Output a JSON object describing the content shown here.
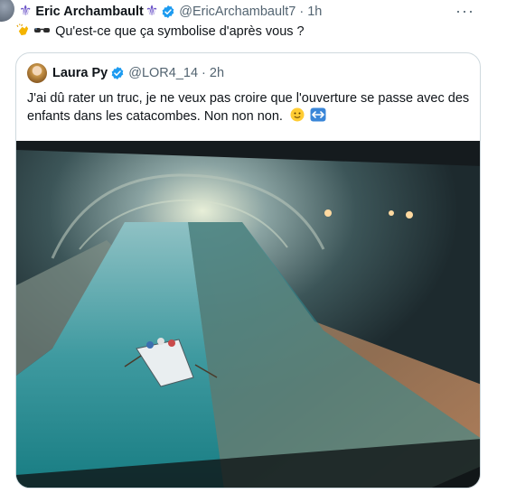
{
  "tweet": {
    "author_name": "Eric Archambault",
    "handle": "@EricArchambault7",
    "separator": "·",
    "time": "1h",
    "more_label": "···",
    "text": "Qu'est-ce que ça symbolise d'après vous ?"
  },
  "quote": {
    "author_name": "Laura Py",
    "handle": "@LOR4_14",
    "separator": "·",
    "time": "2h",
    "text": "J'ai dû rater un truc, je ne veux pas croire que l'ouverture se passe avec des enfants dans les catacombes. Non non non."
  },
  "colors": {
    "verified": "#1d9bf0",
    "fleur": "#6c54c8",
    "muted": "#536471",
    "border": "#cfd9de"
  },
  "icons": [
    "fleur-de-lis-icon",
    "verified-badge-icon",
    "more-icon",
    "clapping-hands-emoji",
    "sunglasses-emoji",
    "slightly-smiling-face-emoji",
    "left-right-arrow-emoji"
  ]
}
